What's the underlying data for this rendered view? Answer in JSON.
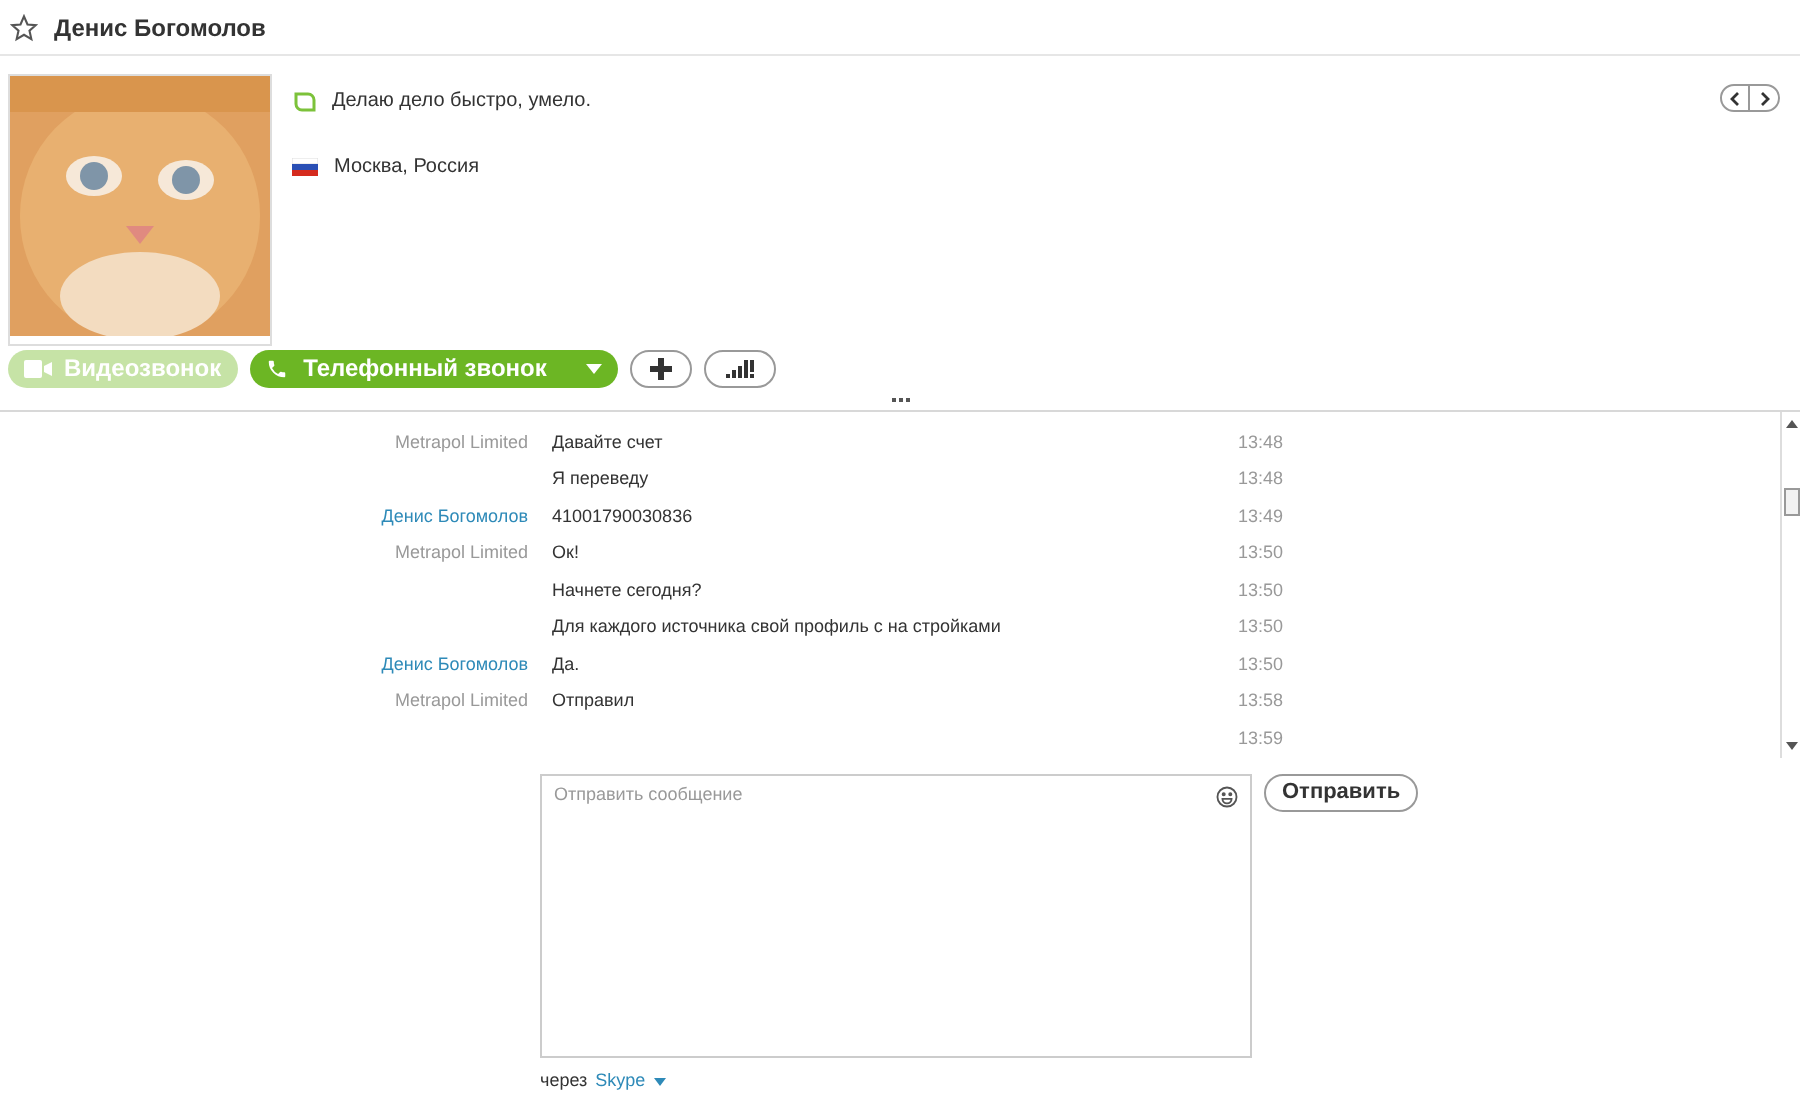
{
  "contact": {
    "name": "Денис Богомолов",
    "favorite": false,
    "mood": "Делаю дело быстро, умело.",
    "location": "Москва, Россия"
  },
  "actions": [
    {
      "kind": "video",
      "label": "Видеозвонок",
      "disabled": true
    },
    {
      "kind": "call",
      "label": "Телефонный звонок",
      "disabled": false
    },
    {
      "kind": "add",
      "disabled": false
    },
    {
      "kind": "signal",
      "disabled": false
    }
  ],
  "messages": [
    {
      "sender": "Metrapol Limited",
      "own": false,
      "text": "Давайте счет",
      "time": "13:48"
    },
    {
      "text": "Я переведу",
      "time": "13:48"
    },
    {
      "sender": "Денис Богомолов",
      "own": true,
      "text": "41001790030836",
      "time": "13:49"
    },
    {
      "sender": "Metrapol Limited",
      "own": false,
      "text": "Ок!",
      "time": "13:50"
    },
    {
      "text": "Начнете сегодня?",
      "time": "13:50"
    },
    {
      "text": "Для каждого источника свой профиль с на стройками",
      "time": "13:50"
    },
    {
      "sender": "Денис Богомолов",
      "own": true,
      "text": "Да.",
      "time": "13:50"
    },
    {
      "sender": "Metrapol Limited",
      "own": false,
      "text": "Отправил",
      "time": "13:58"
    },
    {
      "time": "13:59"
    }
  ],
  "composer": {
    "placeholder": "Отправить сообщение",
    "send": "Отправить",
    "via": "через",
    "service": "Skype"
  }
}
